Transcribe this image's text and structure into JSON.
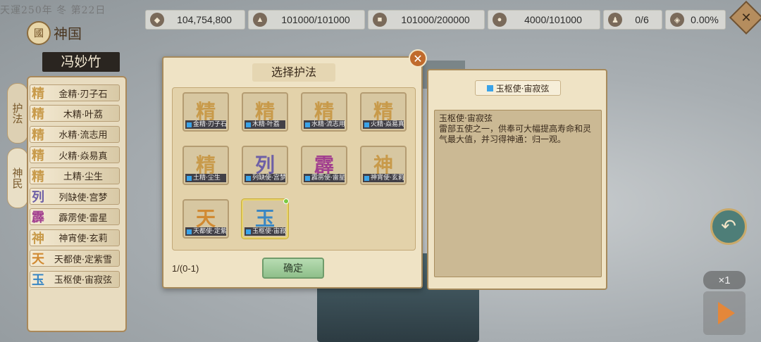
{
  "top_bar": {
    "date_text": "天運250年 冬 第22日",
    "resources": [
      {
        "icon": "treasure-icon",
        "glyph": "◆",
        "value": "104,754,800"
      },
      {
        "icon": "grain-icon",
        "glyph": "▲",
        "value": "101000/101000"
      },
      {
        "icon": "wood-icon",
        "glyph": "■",
        "value": "101000/200000"
      },
      {
        "icon": "ore-icon",
        "glyph": "●",
        "value": "4000/101000"
      },
      {
        "icon": "people-icon",
        "glyph": "♟",
        "value": "0/6"
      },
      {
        "icon": "rate-icon",
        "glyph": "◈",
        "value": "0.00%"
      }
    ],
    "close_glyph": "✕"
  },
  "left_panel": {
    "kingdom_icon_glyph": "國",
    "kingdom_title": "神国",
    "player_name": "冯妙竹",
    "tabs": [
      {
        "label": "护法",
        "active": true
      },
      {
        "label": "神民",
        "active": false
      }
    ],
    "items": [
      {
        "glyph": "精",
        "color": "gold",
        "label": "金精·刃子石"
      },
      {
        "glyph": "精",
        "color": "gold",
        "label": "木精·叶荔"
      },
      {
        "glyph": "精",
        "color": "gold",
        "label": "水精·流志用"
      },
      {
        "glyph": "精",
        "color": "gold",
        "label": "火精·焱易真"
      },
      {
        "glyph": "精",
        "color": "gold",
        "label": "土精·尘生"
      },
      {
        "glyph": "列",
        "color": "purple",
        "label": "列缺使·宫梦"
      },
      {
        "glyph": "霹",
        "color": "magenta",
        "label": "霹雳使·雷星"
      },
      {
        "glyph": "神",
        "color": "gold",
        "label": "神宵使·玄莉"
      },
      {
        "glyph": "天",
        "color": "orange",
        "label": "天都使·定紫雪"
      },
      {
        "glyph": "玉",
        "color": "blue",
        "label": "玉枢使·宙寂弦"
      }
    ]
  },
  "dialog": {
    "title": "选择护法",
    "close_glyph": "✕",
    "cards": [
      {
        "glyph": "精",
        "color": "gold",
        "caption": "金精·刃子石",
        "selected": false
      },
      {
        "glyph": "精",
        "color": "gold",
        "caption": "木精·叶荔",
        "selected": false
      },
      {
        "glyph": "精",
        "color": "gold",
        "caption": "水精·流志用",
        "selected": false
      },
      {
        "glyph": "精",
        "color": "gold",
        "caption": "火精·焱易真",
        "selected": false
      },
      {
        "glyph": "精",
        "color": "gold",
        "caption": "土精·尘生",
        "selected": false
      },
      {
        "glyph": "列",
        "color": "purple",
        "caption": "列缺使·宫梦",
        "selected": false
      },
      {
        "glyph": "霹",
        "color": "magenta",
        "caption": "霹雳使·雷星",
        "selected": false
      },
      {
        "glyph": "神",
        "color": "gold",
        "caption": "神宵使·玄莉",
        "selected": false
      },
      {
        "glyph": "天",
        "color": "orange",
        "caption": "天都使·定紫雪",
        "selected": false
      },
      {
        "glyph": "玉",
        "color": "blue",
        "caption": "玉枢使·宙寂弦",
        "selected": true
      }
    ],
    "count": "1/(0-1)",
    "confirm_label": "确定"
  },
  "detail": {
    "name": "玉枢使·宙寂弦",
    "body_title": "玉枢使·宙寂弦",
    "body_text": "雷部五使之一，供奉可大幅提高寿命和灵气最大值，并习得神通：归一观。"
  },
  "controls": {
    "back_glyph": "↶",
    "speed_label": "×1"
  },
  "colors": {
    "gold": "#c89a4a",
    "purple": "#6d5fa6",
    "magenta": "#a23f8f",
    "orange": "#d18a32",
    "blue": "#3a87c4",
    "confirm_green": "#8fbf8a",
    "accent_blue": "#3aa3e8"
  }
}
